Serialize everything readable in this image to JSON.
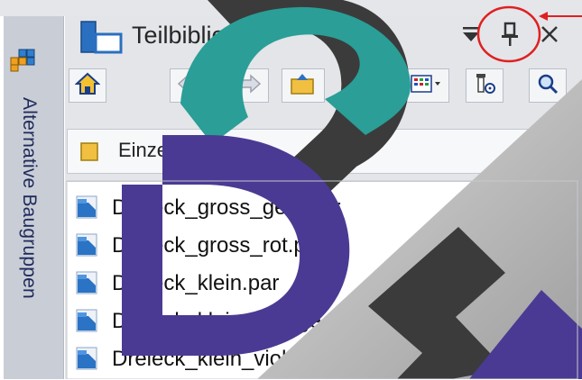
{
  "side_tab": {
    "label": "Alternative Baugruppen"
  },
  "panel": {
    "title": "Teilbibliothek"
  },
  "folder": {
    "name": "Einzelteile"
  },
  "files": [
    "Dreieck_gross_gelb.par",
    "Dreieck_gross_rot.par",
    "Dreieck_klein.par",
    "Dreieck_klein_orange.par",
    "Dreieck_klein_violett.par"
  ],
  "colors": {
    "highlight_circle": "#e02020",
    "logo_teal": "#2a9e97",
    "logo_purple": "#4b3a93",
    "logo_dark": "#3b3b3b",
    "side_tab_text": "#1f2a5c"
  },
  "icons": [
    "assemblies-icon",
    "library-icon",
    "pin-icon",
    "close-icon",
    "dropdown-arrow-icon",
    "home-icon",
    "back-icon",
    "forward-icon",
    "up-folder-icon",
    "new-folder-icon",
    "view-icon",
    "filter-icon",
    "search-icon",
    "folder-icon",
    "part-file-icon"
  ]
}
